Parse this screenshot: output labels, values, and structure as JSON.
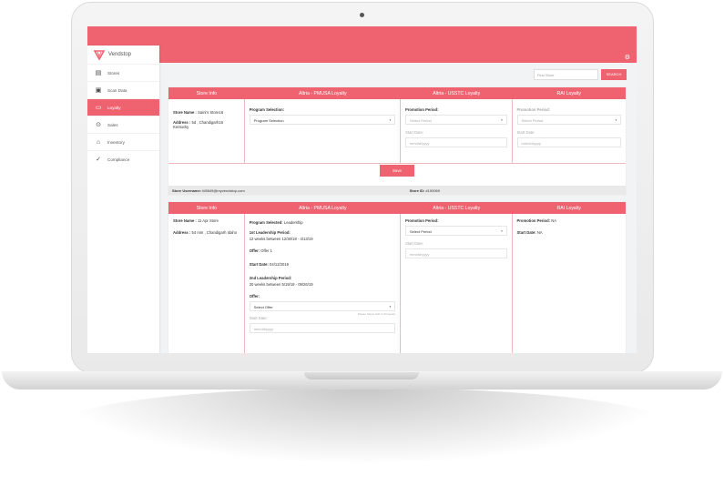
{
  "brand": {
    "name": "Vendstop"
  },
  "sidebar": {
    "items": [
      {
        "label": "Stores",
        "icon": "store-icon"
      },
      {
        "label": "Scan Data",
        "icon": "scan-icon"
      },
      {
        "label": "Loyalty",
        "icon": "card-icon",
        "active": true
      },
      {
        "label": "Sales",
        "icon": "dollar-icon"
      },
      {
        "label": "Inventory",
        "icon": "warehouse-icon"
      },
      {
        "label": "Compliance",
        "icon": "check-circle-icon"
      }
    ]
  },
  "search": {
    "placeholder": "Find Store",
    "button_label": "SEARCH"
  },
  "colors": {
    "accent": "#ef6371",
    "background": "#f2f3f5"
  },
  "card1": {
    "headers": [
      "Store Info",
      "Altria - PMUSA Loyalty",
      "Altria - USSTC Loyalty",
      "RAI Loyalty"
    ],
    "store_name_label": "Store Name :",
    "store_name": "Saini's Store16",
    "address_label": "Address :",
    "address": "5d , Chandigarh16 Kentucky",
    "program_selection_label": "Program Selection:",
    "program_selection_value": "Program Selection",
    "usstc_promo_label": "Promotion Period:",
    "usstc_promo_value": "Select Period",
    "usstc_start_label": "Start Date:",
    "usstc_start_placeholder": "mm/dd/yyyy",
    "rai_promo_label": "Promotion Period:",
    "rai_promo_value": "Select Period",
    "rai_start_label": "Start Date:",
    "rai_start_placeholder": "mm/dd/yyyy",
    "save_label": "Save",
    "username_label": "Store Username:",
    "username": "fd5649@myvendstop.com",
    "store_id_label": "Store ID:",
    "store_id": "#100069"
  },
  "card2": {
    "headers": [
      "Store Info",
      "Altria - PMUSA Loyalty",
      "Altria - USSTC Loyalty",
      "RAI Loyalty"
    ],
    "store_name_label": "Store Name :",
    "store_name": "11 Apr Store",
    "address_label": "Address :",
    "address": "54 mm , Chandigarh Idaho",
    "program_selected_label": "Program Selected:",
    "program_selected": "Leadership",
    "period1_label": "1st Leadership Period:",
    "period1_value": "12 weeks between 12/30/18 - 4/13/19",
    "offer1_label": "Offer:",
    "offer1_value": "Offer 1",
    "start1_label": "Start Date:",
    "start1_value": "04/12/2019",
    "period2_label": "2nd Leadership Period:",
    "period2_value": "20 weeks between 5/19/19 - 09/26/19",
    "offer2_label": "Offer:",
    "offer2_select": "Select Offer",
    "offer2_hint": "Please Select with in 20 weeks",
    "start2_label": "Start Date:",
    "start2_placeholder": "mm/dd/yyyy",
    "usstc_promo_label": "Promotion Period:",
    "usstc_promo_value": "Select Period",
    "usstc_start_label": "Start Date:",
    "usstc_start_placeholder": "mm/dd/yyyy",
    "rai_promo_label": "Promotion Period:",
    "rai_promo_value": "NA",
    "rai_start_label": "Start Date:",
    "rai_start_value": "NA"
  }
}
